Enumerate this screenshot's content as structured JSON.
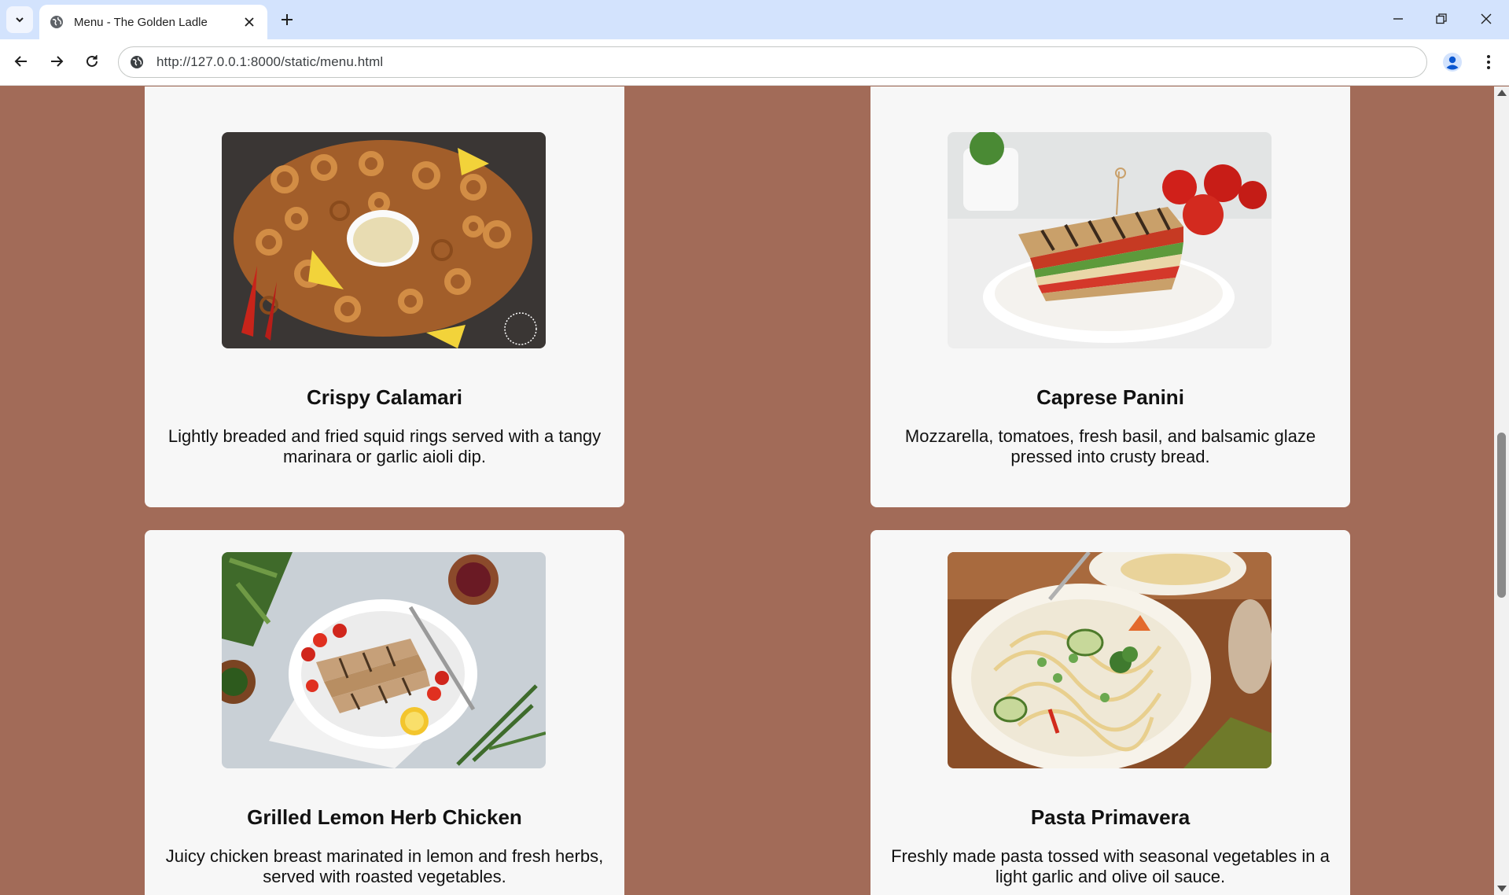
{
  "browser": {
    "tab_title": "Menu - The Golden Ladle",
    "url": "http://127.0.0.1:8000/static/menu.html"
  },
  "menu_items": [
    {
      "name": "Crispy Calamari",
      "description": "Lightly breaded and fried squid rings served with a tangy marinara or garlic aioli dip.",
      "image": "fried-calamari-photo"
    },
    {
      "name": "Caprese Panini",
      "description": "Mozzarella, tomatoes, fresh basil, and balsamic glaze pressed into crusty bread.",
      "image": "panini-sandwich-photo"
    },
    {
      "name": "Grilled Lemon Herb Chicken",
      "description": "Juicy chicken breast marinated in lemon and fresh herbs, served with roasted vegetables.",
      "image": "grilled-chicken-photo"
    },
    {
      "name": "Pasta Primavera",
      "description": "Freshly made pasta tossed with seasonal vegetables in a light garlic and olive oil sauce.",
      "image": "pasta-primavera-photo"
    }
  ],
  "colors": {
    "page_background": "#a26b58",
    "card_background": "#f7f7f7",
    "tab_strip": "#d3e3fd"
  }
}
